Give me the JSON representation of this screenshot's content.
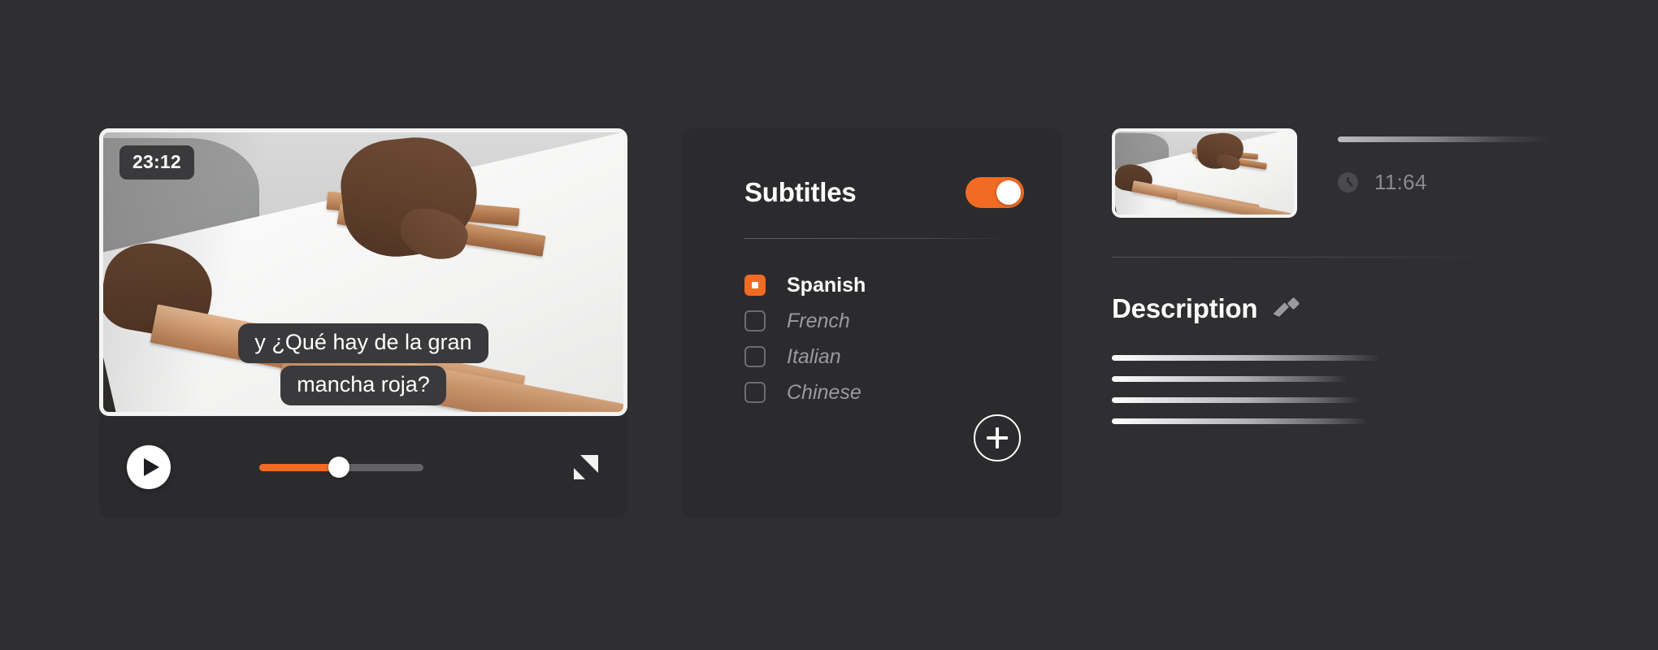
{
  "theme": {
    "background": "#2f2f31",
    "card_background": "#2b2b2d",
    "accent": "#f26b22",
    "text_primary": "#ffffff",
    "text_muted": "#9a9a9d"
  },
  "player": {
    "timestamp_badge": "23:12",
    "caption_lines": [
      "y ¿Qué hay de la gran",
      "mancha roja?"
    ],
    "controls": {
      "play_label": "Play",
      "play_icon": "play-icon",
      "fullscreen_icon": "fullscreen-icon",
      "volume_percent": 49
    }
  },
  "subtitles": {
    "title": "Subtitles",
    "enabled": true,
    "toggle_icon": "toggle-on-icon",
    "languages": [
      {
        "label": "Spanish",
        "selected": true
      },
      {
        "label": "French",
        "selected": false
      },
      {
        "label": "Italian",
        "selected": false
      },
      {
        "label": "Chinese",
        "selected": false
      }
    ],
    "add_button": {
      "icon": "plus-icon",
      "label": "+"
    }
  },
  "details": {
    "thumbnail_icon": "video-thumbnail",
    "title_placeholder": "",
    "duration": "11:64",
    "clock_icon": "clock-icon",
    "description": {
      "title": "Description",
      "edit_icon": "pencil-icon",
      "placeholder_lines": 4
    }
  }
}
